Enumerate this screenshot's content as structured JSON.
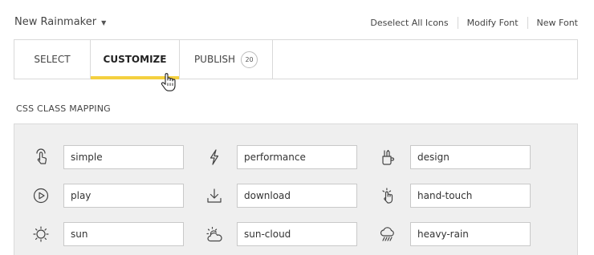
{
  "header": {
    "font_name": "New Rainmaker",
    "actions": [
      "Deselect All Icons",
      "Modify Font",
      "New Font"
    ]
  },
  "tabs": [
    {
      "label": "SELECT"
    },
    {
      "label": "CUSTOMIZE",
      "active": true
    },
    {
      "label": "PUBLISH",
      "badge": "20"
    }
  ],
  "section": {
    "title": "CSS CLASS MAPPING"
  },
  "mappings": [
    {
      "icon": "touch-icon",
      "value": "simple"
    },
    {
      "icon": "lightning-icon",
      "value": "performance"
    },
    {
      "icon": "design-tools-icon",
      "value": "design"
    },
    {
      "icon": "play-icon",
      "value": "play"
    },
    {
      "icon": "download-icon",
      "value": "download"
    },
    {
      "icon": "hand-touch-icon",
      "value": "hand-touch"
    },
    {
      "icon": "sun-icon",
      "value": "sun"
    },
    {
      "icon": "sun-cloud-icon",
      "value": "sun-cloud"
    },
    {
      "icon": "heavy-rain-icon",
      "value": "heavy-rain"
    }
  ],
  "colors": {
    "accent": "#f4d03f",
    "panel_bg": "#efefef",
    "border": "#d9d9d9"
  }
}
